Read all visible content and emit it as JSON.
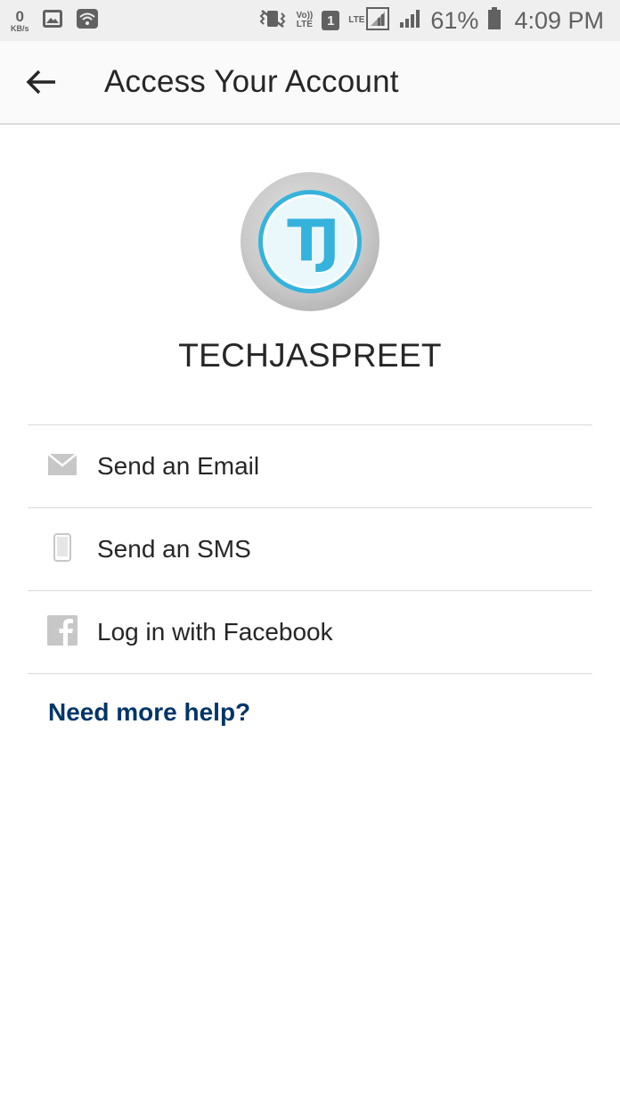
{
  "status_bar": {
    "speed_value": "0",
    "speed_unit": "KB/s",
    "volte_top": "Vo))",
    "volte_bottom": "LTE",
    "sim_number": "1",
    "lte_label": "LTE",
    "battery_percent": "61%",
    "time": "4:09 PM"
  },
  "app_bar": {
    "title": "Access Your Account"
  },
  "profile": {
    "avatar_initials": "TJ",
    "username": "TECHJASPREET"
  },
  "options": [
    {
      "label": "Send an Email",
      "icon": "mail-icon"
    },
    {
      "label": "Send an SMS",
      "icon": "phone-icon"
    },
    {
      "label": "Log in with Facebook",
      "icon": "facebook-icon"
    }
  ],
  "help": {
    "link_label": "Need more help?"
  },
  "colors": {
    "link": "#003569",
    "text": "#262626",
    "divider": "#dbdbdb",
    "avatar_accent": "#35b3dd",
    "icon_gray": "#c7c7c7"
  }
}
